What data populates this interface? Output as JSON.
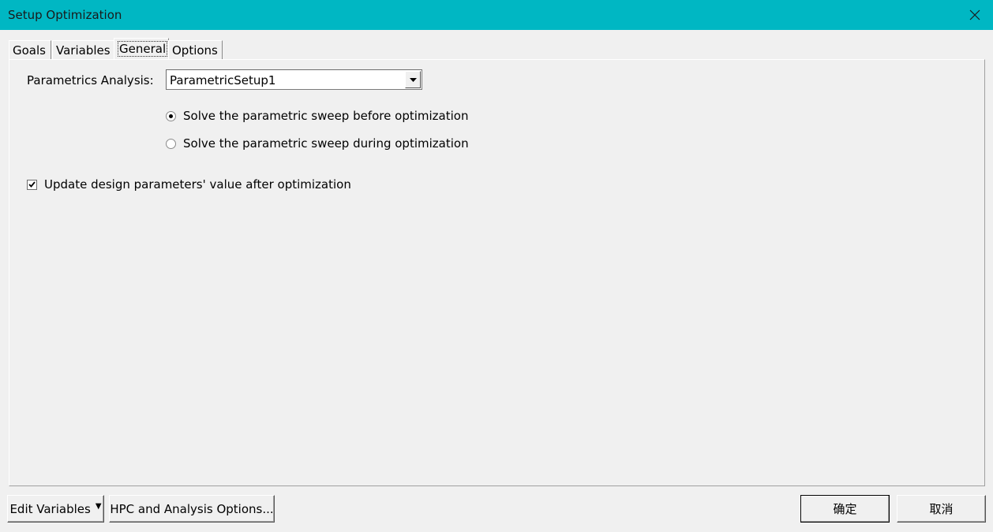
{
  "window": {
    "title": "Setup Optimization",
    "close_icon": "close-icon",
    "titlebar_color": "#00b7c3"
  },
  "tabs": [
    {
      "label": "Goals",
      "active": false
    },
    {
      "label": "Variables",
      "active": false
    },
    {
      "label": "General",
      "active": true
    },
    {
      "label": "Options",
      "active": false
    }
  ],
  "general": {
    "parametrics_label": "Parametrics Analysis:",
    "parametrics_value": "ParametricSetup1",
    "radio_before": {
      "label": "Solve the parametric sweep before optimization",
      "checked": true
    },
    "radio_during": {
      "label": "Solve the parametric sweep during optimization",
      "checked": false
    },
    "update_checkbox": {
      "label": "Update design parameters' value after optimization",
      "checked": true
    }
  },
  "buttons": {
    "edit_variables": "Edit Variables",
    "hpc_options": "HPC and Analysis Options...",
    "ok": "确定",
    "cancel": "取消"
  }
}
